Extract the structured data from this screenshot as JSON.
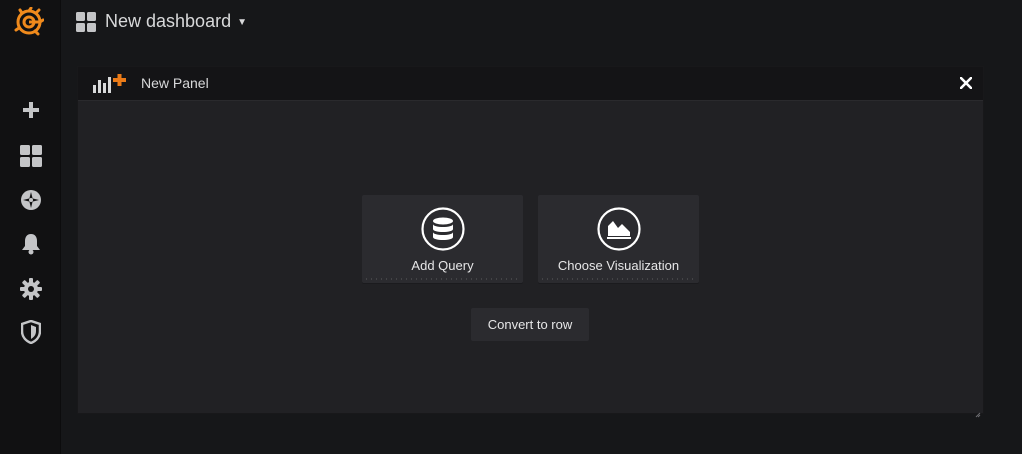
{
  "header": {
    "dashboard_title": "New dashboard",
    "caret_icon": "caret-down-icon"
  },
  "sidemenu": {
    "logo": "grafana-logo",
    "items": [
      {
        "icon": "plus-icon",
        "label": "Create"
      },
      {
        "icon": "dashboards-icon",
        "label": "Dashboards"
      },
      {
        "icon": "explore-compass-icon",
        "label": "Explore"
      },
      {
        "icon": "bell-icon",
        "label": "Alerting"
      },
      {
        "icon": "gear-icon",
        "label": "Configuration"
      },
      {
        "icon": "shield-icon",
        "label": "Server Admin"
      }
    ]
  },
  "panel": {
    "title": "New Panel",
    "close_icon": "close-icon",
    "actions": [
      {
        "label": "Add Query",
        "icon": "database-icon"
      },
      {
        "label": "Choose Visualization",
        "icon": "area-chart-icon"
      }
    ],
    "convert_label": "Convert to row"
  },
  "colors": {
    "accent": "#eb7b18",
    "background": "#161719",
    "panel": "#212124",
    "card": "#2b2b2f"
  }
}
